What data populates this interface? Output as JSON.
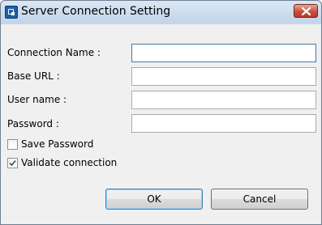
{
  "window": {
    "title": "Server Connection Setting",
    "icon": "app-icon",
    "close_icon": "close-icon"
  },
  "form": {
    "connection_name": {
      "label": "Connection Name :",
      "value": ""
    },
    "base_url": {
      "label": "Base URL :",
      "value": ""
    },
    "user_name": {
      "label": "User name :",
      "value": ""
    },
    "password": {
      "label": "Password :",
      "value": ""
    }
  },
  "options": {
    "save_password": {
      "label": "Save Password",
      "checked": false
    },
    "validate_connection": {
      "label": "Validate connection",
      "checked": true
    }
  },
  "buttons": {
    "ok": "OK",
    "cancel": "Cancel"
  },
  "colors": {
    "titlebar": "#c4d6ea",
    "close_button": "#c8503d",
    "focus_border": "#3d7bad"
  }
}
